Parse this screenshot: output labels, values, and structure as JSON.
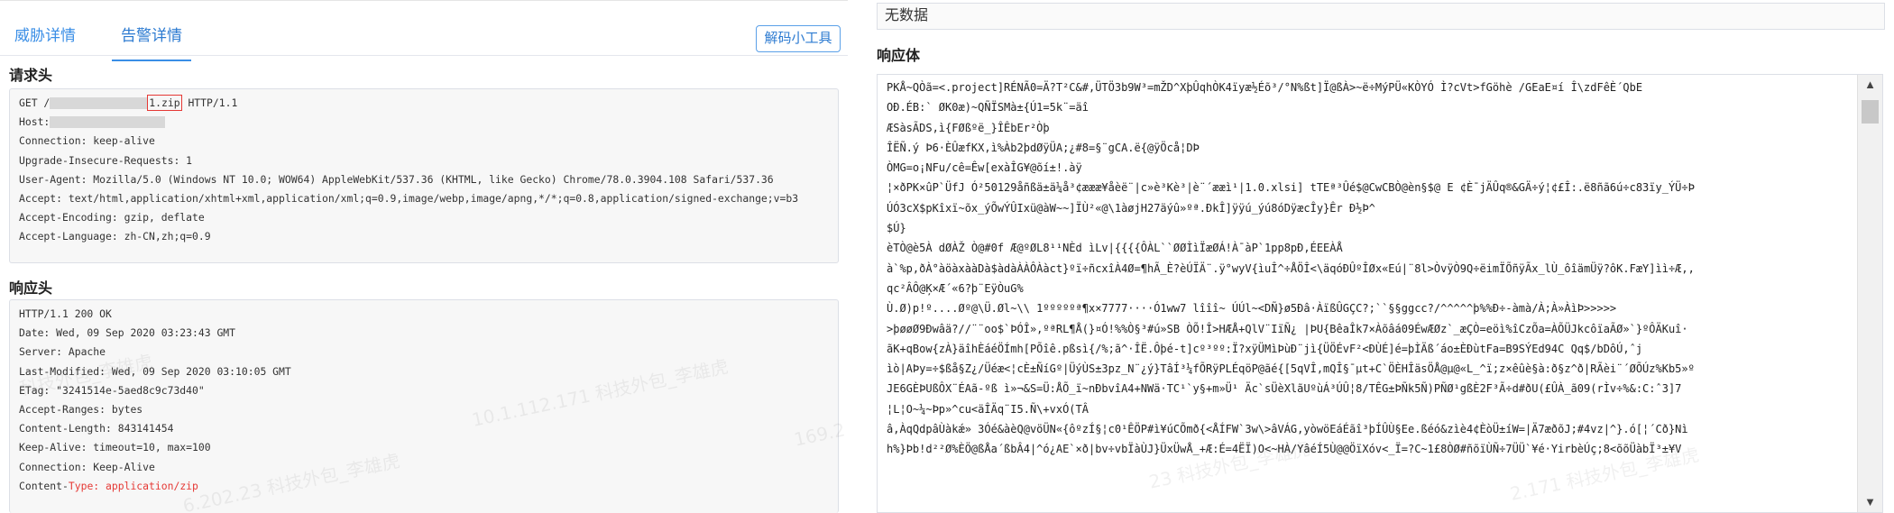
{
  "tabs": [
    {
      "label": "威胁详情",
      "active": false
    },
    {
      "label": "告警详情",
      "active": true
    }
  ],
  "decode_button": "解码小工具",
  "request_header": {
    "title": "请求头",
    "get_prefix": "GET /",
    "get_highlight": "1.zip",
    "get_suffix": " HTTP/1.1",
    "host_label": "Host:",
    "lines": [
      "Connection: keep-alive",
      "Upgrade-Insecure-Requests: 1",
      "User-Agent: Mozilla/5.0 (Windows NT 10.0; WOW64) AppleWebKit/537.36 (KHTML, like Gecko) Chrome/78.0.3904.108 Safari/537.36",
      "Accept: text/html,application/xhtml+xml,application/xml;q=0.9,image/webp,image/apng,*/*;q=0.8,application/signed-exchange;v=b3",
      "Accept-Encoding: gzip, deflate",
      "Accept-Language: zh-CN,zh;q=0.9"
    ]
  },
  "response_header": {
    "title": "响应头",
    "lines": [
      "HTTP/1.1 200 OK",
      "Date: Wed, 09 Sep 2020 03:23:43 GMT",
      "Server: Apache",
      "Last-Modified: Wed, 09 Sep 2020 03:10:05 GMT",
      "ETag: \"3241514e-5aed8c9c73d40\"",
      "Accept-Ranges: bytes",
      "Content-Length: 843141454",
      "Keep-Alive: timeout=10, max=100",
      "Connection: Keep-Alive"
    ],
    "content_type_label": "Content-",
    "content_type_value": "Type: application/zip"
  },
  "watermarks": [
    "科技外包_李雄虎",
    "10.1.112.171 科技外包_李雄虎",
    "6.202.23 科技外包_李雄虎",
    "169.2",
    "23 科技外包_李雄虎",
    "2.171 科技外包_李雄虎"
  ],
  "request_body_value": "无数据",
  "response_body": {
    "title": "响应体",
    "lines": [
      "PKÅ~QÒã=<.project]RÉNÃ0=Ä?T²C&#,ÜTÖ3b9W³=mŽD^XþÛqhÒK4ïyæ½Éõ³/°N%ßt]Ï@ßÀ>~ë÷MýPÜ«KÒYÓ    Ì?cVt>fGöhè /GEaE¤í     Î\\zdFêÈ´QbE",
      "OÐ.ÉB:` ØK0æ)~QÑÏSMà±{Ú1=5k¨=äî",
      "ÆSàsÃDS,ì{FØßºë_}ÎÊbEr²Òþ",
      "ÎËÑ.ý   Þ6·ÈÛæfKX,ì%Àb2þdØÿÜA;¿#8=§¨gCA.ë{@ÿÖcå¦DÞ",
      "ÒMG=o¡NFu/cê=Êw[exàÎG¥@õí±!.àÿ",
      "¦×ðPK×ûP`ÜfJ Ó²50129åñßä±ä¼å³¢æææ¥åèë¨|c»è³Kè³|è¨´ææì¹|1.0.xlsi]    tTEª³Ûé$@CwCBÒ@èn§$@ E ¢È¯jÄÛq®&GÄ÷ý¦¢£Î:.ë8ñã6ú÷c83ïy_ÝÜ÷Þ",
      "ÚÓ3cX$pKîxï~õx_ýÕwÝÛIxü@àW~~]ÏÙ²«@\\1àøjH27äýû»ºª.ÐkÎ]ÿÿú_ýú8óDÿæcÎy}Êr Ð½Þ^",
      "$Ú}",
      " èTÒ@è5À  dØÀŽ Ò@#0f Æ@ºØL8¹¹NÈd ìLv|{{{{ÔÀL``ØØÌìÏæØÁ!À¯àP`1pp8pÐ,ÉEEÀÅ",
      "à`%p,ðÀ°àöàxààDà$àdàÀÀÔÀàct}ºï÷ñcxîÀ4Ø=¶hÃ_È?èÚÏÄ¨.ÿ°wyV{ìuÎ^÷ÅÖÎ<\\äqóÐÛºÎØx«Eú|¨8l>ÒvÿÒ9Q÷ëimÏÕñÿÃx_lÙ_ôîämÜÿ?ôK.FæY]ìì÷Æ,,",
      "qc²ÂÔ@Ķ×Æ´«6?þ¨EÿÒuG%",
      "         Ù.Ø)p!º....Øº@\\Ü.Øl~\\\\  1ºººººª¶x×7777····Ó1ww7   lîîî~    ÚÚl~<DÑ}ø5Ðâ·ÀïßÛGÇC?;``§§ggcc?/^^^^^þ%%Ð÷-àmà/À;À»ÀìÞ>>>>>",
      ">þøøØ9Ðwâä?//¨¨oo$`ÞÓÎ»,ºªRL¶Å(}¤Ó!%%Ò§³#ú»SB ÒÕ!Î>HÆÅ+QlV¨IïÑ¿ |ÞU{BêaÎk7×Àõâá09ÉwÆØz`_æÇÒ=eöì%îCzÕa=ÀÕÜJkcôïaÃØ»`}ºÔÄKuî·",
      "ãK+qBow{zÀ}äîhÈáéÖÍmh[PÕîê.pßsì{/%;ã^·ÎË.Ôþé-t]cº³ºº:Ï?xÿÜMìÞùÐ¨jì{ÜÖÉvF²<ÐÙÉ]é=þÌÄß´áo±ÈÐùtFa=B9SÝEd94C        Qq$/bDôÚ,ˆj",
      "ìò|AÞy=÷$ßå§Z¿/Üéæ<¦cÈ±ÑíGº|ÜýÙS±3pz_N¨¿ý}TâÍ³¼fÕRÿPLÉqöP@ãé{[5qVÎ,mQÎ§¯µt+C`ÖÈHÎäsÖÅ@µ@«L_^ï;z×êûè§à:ð§z^ð|RÃèi¨´ØÕÚz%Kb5»º",
      "JE6GÈÞUßÔX¨ÉAã-ºß ì»¬&S=Ü:ÅÕ_ï~nÐbvîA4+NWä·TC¹`y§+m»Ü¹  Äc`sÜèXlãUºùÁ³ÚÛ¦8/TÊG±ÞÑk5Ñ)PÑØ¹gßÈ2F³Ã÷d#ðU(£ÛÀ_ã09(rÌv÷%&:C:ˆ3]7",
      "¦L¦O~¼~Þp»^cu<äÎÄq¨I5.Ñ\\+vxÓ(TÂ",
      "â,ÀqQdpâÙàkǽ» 3Óé&àèQ@vöÜN«{ôºzÍ§¦c0¹ÊÖP#ì¥úCÕmð{<ÅÍFW`3w\\>âVÁG,yòwöEáÉãî³þÍÛÙ§Ee.ßéó&zìè4¢ÈòÜ±íW=|Ä7æðõJ;#4vz|^}.ó[¦´Cð}Nì",
      "h%}Þb!d²²Ø%ÈÖ@ßÅa´ßbÂ4|^ó¿AE`×ð|bv÷vbÏàÙJ}ÜxÜwÅ_+Æ:É=4ËÏ)O<~HÀ/YâéÍ5Ù@@ÖïXóv<_Ï=?C~1£8ÒØ#ñõïÙÑ÷7ÜÜ`¥é·YirbèÚç;8<õõÜàbÏ³±¥V"
    ]
  }
}
